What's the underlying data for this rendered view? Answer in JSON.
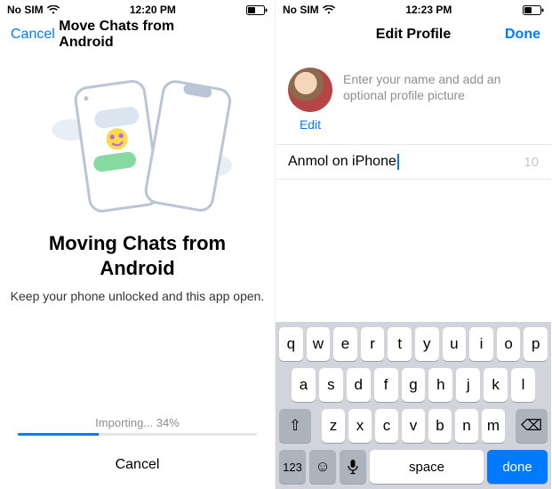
{
  "left": {
    "status": {
      "carrier": "No SIM",
      "time": "12:20 PM"
    },
    "nav": {
      "cancel": "Cancel",
      "title": "Move Chats from Android"
    },
    "heading": "Moving Chats from Android",
    "subtitle": "Keep your phone unlocked and this app open.",
    "progress": {
      "label": "Importing... 34%",
      "percent": 34
    },
    "bottom_cancel": "Cancel"
  },
  "right": {
    "status": {
      "carrier": "No SIM",
      "time": "12:23 PM"
    },
    "nav": {
      "title": "Edit Profile",
      "done": "Done"
    },
    "hint": "Enter your name and add an optional profile picture",
    "edit_link": "Edit",
    "name_value": "Anmol on iPhone",
    "char_remaining": "10",
    "keyboard": {
      "row1": [
        "q",
        "w",
        "e",
        "r",
        "t",
        "y",
        "u",
        "i",
        "o",
        "p"
      ],
      "row2": [
        "a",
        "s",
        "d",
        "f",
        "g",
        "h",
        "j",
        "k",
        "l"
      ],
      "row3": [
        "z",
        "x",
        "c",
        "v",
        "b",
        "n",
        "m"
      ],
      "shift": "⇧",
      "backspace": "⌫",
      "numkey": "123",
      "emoji": "☺",
      "mic": "🎤",
      "space": "space",
      "done": "done"
    }
  }
}
